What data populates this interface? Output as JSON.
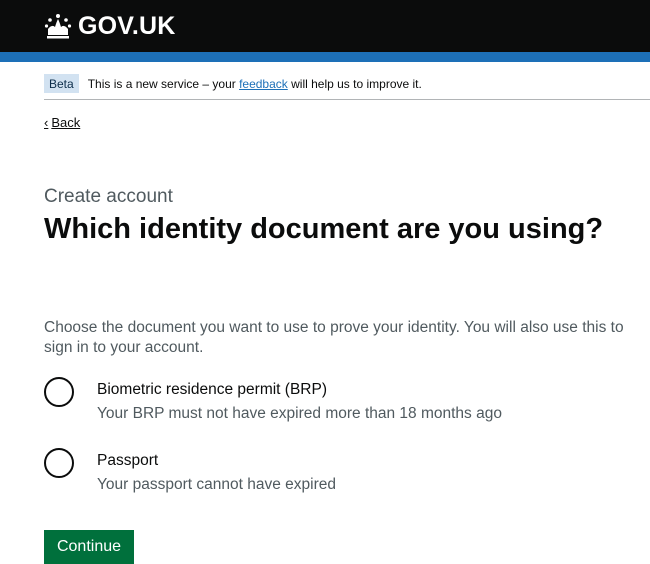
{
  "header": {
    "logo_text": "GOV.UK",
    "icon": "crown-icon"
  },
  "phase_banner": {
    "tag": "Beta",
    "text_before": "This is a new service – your ",
    "link": "feedback",
    "text_after": " will help us to improve it."
  },
  "back_link": {
    "label": "Back",
    "icon": "chevron-left-icon"
  },
  "form": {
    "caption": "Create account",
    "heading": "Which identity document are you using?",
    "hint": "Choose the document you want to use to prove your identity. You will also use this to sign in to your account.",
    "options": [
      {
        "label": "Biometric residence permit (BRP)",
        "hint": "Your BRP must not have expired more than 18 months ago",
        "selected": false
      },
      {
        "label": "Passport",
        "hint": "Your passport cannot have expired",
        "selected": false
      }
    ],
    "submit_label": "Continue"
  },
  "colors": {
    "header_bg": "#0b0c0c",
    "header_bar": "#1d70b8",
    "tag_bg": "#d2e2f1",
    "link": "#1d70b8",
    "button_bg": "#00703c",
    "secondary_text": "#505a5f"
  }
}
